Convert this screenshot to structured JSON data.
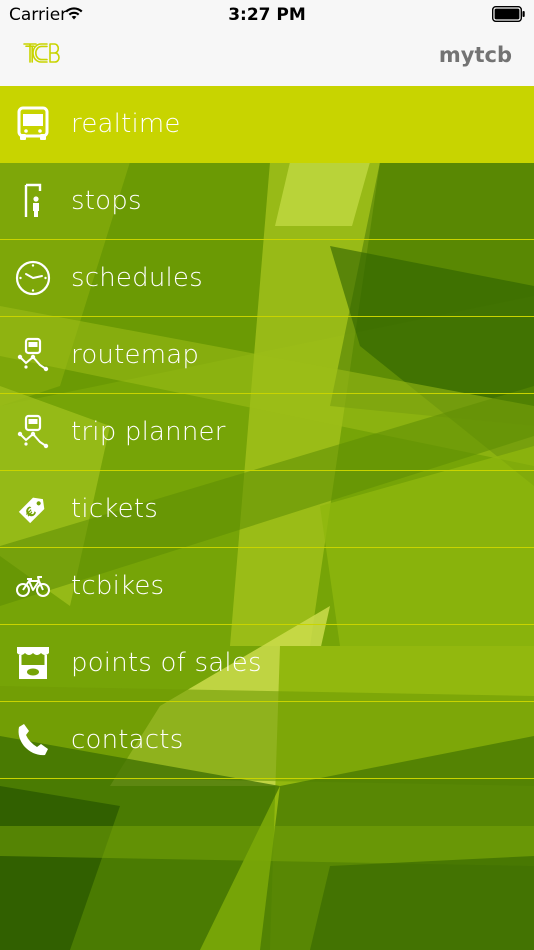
{
  "status_bar": {
    "carrier": "Carrier",
    "time": "3:27 PM"
  },
  "nav": {
    "logo": "TCB",
    "title": "mytcb"
  },
  "colors": {
    "accent": "#c8d400",
    "nav_title": "#737373",
    "divider": "#c9d400"
  },
  "menu": [
    {
      "label": "realtime",
      "icon": "bus-icon",
      "active": true
    },
    {
      "label": "stops",
      "icon": "bus-stop-icon"
    },
    {
      "label": "schedules",
      "icon": "clock-icon"
    },
    {
      "label": "routemap",
      "icon": "route-map-icon"
    },
    {
      "label": "trip planner",
      "icon": "trip-planner-icon"
    },
    {
      "label": "tickets",
      "icon": "ticket-icon"
    },
    {
      "label": "tcbikes",
      "icon": "bike-icon"
    },
    {
      "label": "points of sales",
      "icon": "kiosk-icon"
    },
    {
      "label": "contacts",
      "icon": "phone-icon"
    }
  ]
}
